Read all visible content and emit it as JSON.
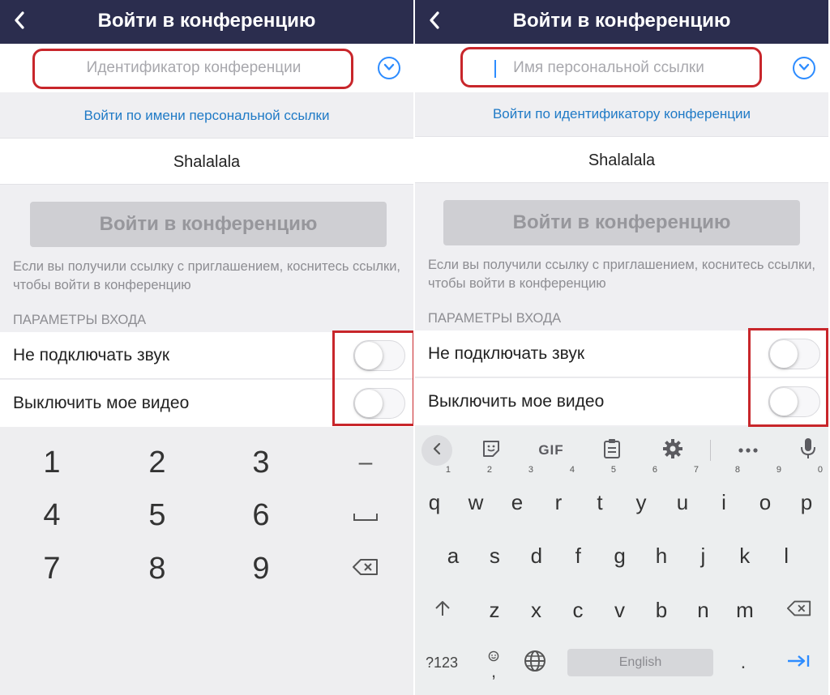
{
  "accent_color": "#2d8cff",
  "header_color": "#2b2d4e",
  "highlight_color": "#c8262b",
  "panels": [
    {
      "title": "Войти в конференцию",
      "back_icon": "chevron-left-icon",
      "id_placeholder": "Идентификатор конференции",
      "switch_link": "Войти по имени персональной ссылки",
      "display_name": "Shalalala",
      "join_button": "Войти в конференцию",
      "hint": "Если вы получили ссылку с приглашением, коснитесь ссылки, чтобы войти в конференцию",
      "params_header": "ПАРАМЕТРЫ ВХОДА",
      "option_audio": "Не подключать звук",
      "option_video": "Выключить мое видео",
      "option_audio_on": false,
      "option_video_on": false
    },
    {
      "title": "Войти в конференцию",
      "back_icon": "chevron-left-icon",
      "id_placeholder": "Имя персональной ссылки",
      "switch_link": "Войти по идентификатору конференции",
      "display_name": "Shalalala",
      "join_button": "Войти в конференцию",
      "hint": "Если вы получили ссылку с приглашением, коснитесь ссылки, чтобы войти в конференцию",
      "params_header": "ПАРАМЕТРЫ ВХОДА",
      "option_audio": "Не подключать звук",
      "option_video": "Выключить мое видео",
      "option_audio_on": false,
      "option_video_on": false
    }
  ],
  "numpad": {
    "keys": [
      "1",
      "2",
      "3",
      "4",
      "5",
      "6",
      "7",
      "8",
      "9"
    ],
    "minus": "–",
    "space_icon": "space-icon",
    "backspace_icon": "backspace-icon"
  },
  "keyboard": {
    "toolbar_gif": "GIF",
    "toolbar_icons": [
      "chevron-left-icon",
      "sticker-icon",
      "clipboard-icon",
      "gear-icon",
      "more-icon",
      "microphone-icon"
    ],
    "row1": [
      {
        "k": "q",
        "n": "1"
      },
      {
        "k": "w",
        "n": "2"
      },
      {
        "k": "e",
        "n": "3"
      },
      {
        "k": "r",
        "n": "4"
      },
      {
        "k": "t",
        "n": "5"
      },
      {
        "k": "y",
        "n": "6"
      },
      {
        "k": "u",
        "n": "7"
      },
      {
        "k": "i",
        "n": "8"
      },
      {
        "k": "o",
        "n": "9"
      },
      {
        "k": "p",
        "n": "0"
      }
    ],
    "row2": [
      "a",
      "s",
      "d",
      "f",
      "g",
      "h",
      "j",
      "k",
      "l"
    ],
    "row3": [
      "z",
      "x",
      "c",
      "v",
      "b",
      "n",
      "m"
    ],
    "symbols_key": "?123",
    "comma_key": ",",
    "period_key": ".",
    "space_label": "English",
    "shift_icon": "shift-icon",
    "emoji_icon": "emoji-icon",
    "globe_icon": "globe-icon",
    "backspace_icon": "backspace-icon",
    "enter_icon": "tab-next-icon"
  }
}
